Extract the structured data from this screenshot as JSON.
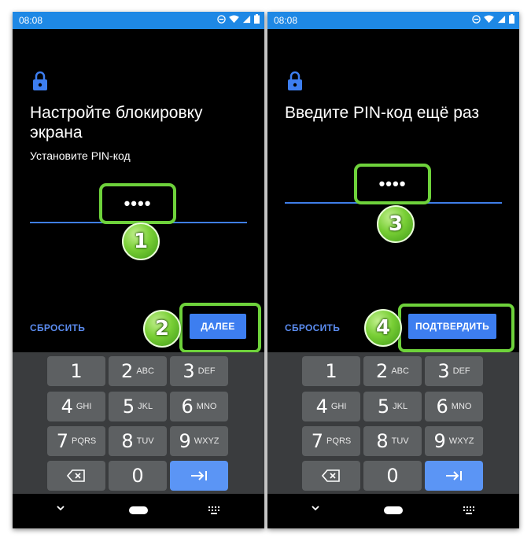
{
  "left": {
    "time": "08:08",
    "title": "Настройте блокировку экрана",
    "subtitle": "Установите PIN-код",
    "pin_dots": "••••",
    "badge_pin": "1",
    "badge_action": "2",
    "reset_label": "СБРОСИТЬ",
    "action_label": "ДАЛЕЕ"
  },
  "right": {
    "time": "08:08",
    "title": "Введите PIN-код ещё раз",
    "pin_dots": "••••",
    "badge_pin": "3",
    "badge_action": "4",
    "reset_label": "СБРОСИТЬ",
    "action_label": "ПОДТВЕРДИТЬ"
  },
  "keypad": {
    "k1": {
      "digit": "1",
      "letters": ""
    },
    "k2": {
      "digit": "2",
      "letters": "ABC"
    },
    "k3": {
      "digit": "3",
      "letters": "DEF"
    },
    "k4": {
      "digit": "4",
      "letters": "GHI"
    },
    "k5": {
      "digit": "5",
      "letters": "JKL"
    },
    "k6": {
      "digit": "6",
      "letters": "MNO"
    },
    "k7": {
      "digit": "7",
      "letters": "PQRS"
    },
    "k8": {
      "digit": "8",
      "letters": "TUV"
    },
    "k9": {
      "digit": "9",
      "letters": "WXYZ"
    },
    "k0": {
      "digit": "0",
      "letters": ""
    }
  },
  "colors": {
    "status_bar": "#1e88e5",
    "highlight_green": "#6ed23b",
    "accent_blue": "#3d7ef0",
    "keypad_bg": "#3a3c3e",
    "key_bg": "#5d6062"
  }
}
